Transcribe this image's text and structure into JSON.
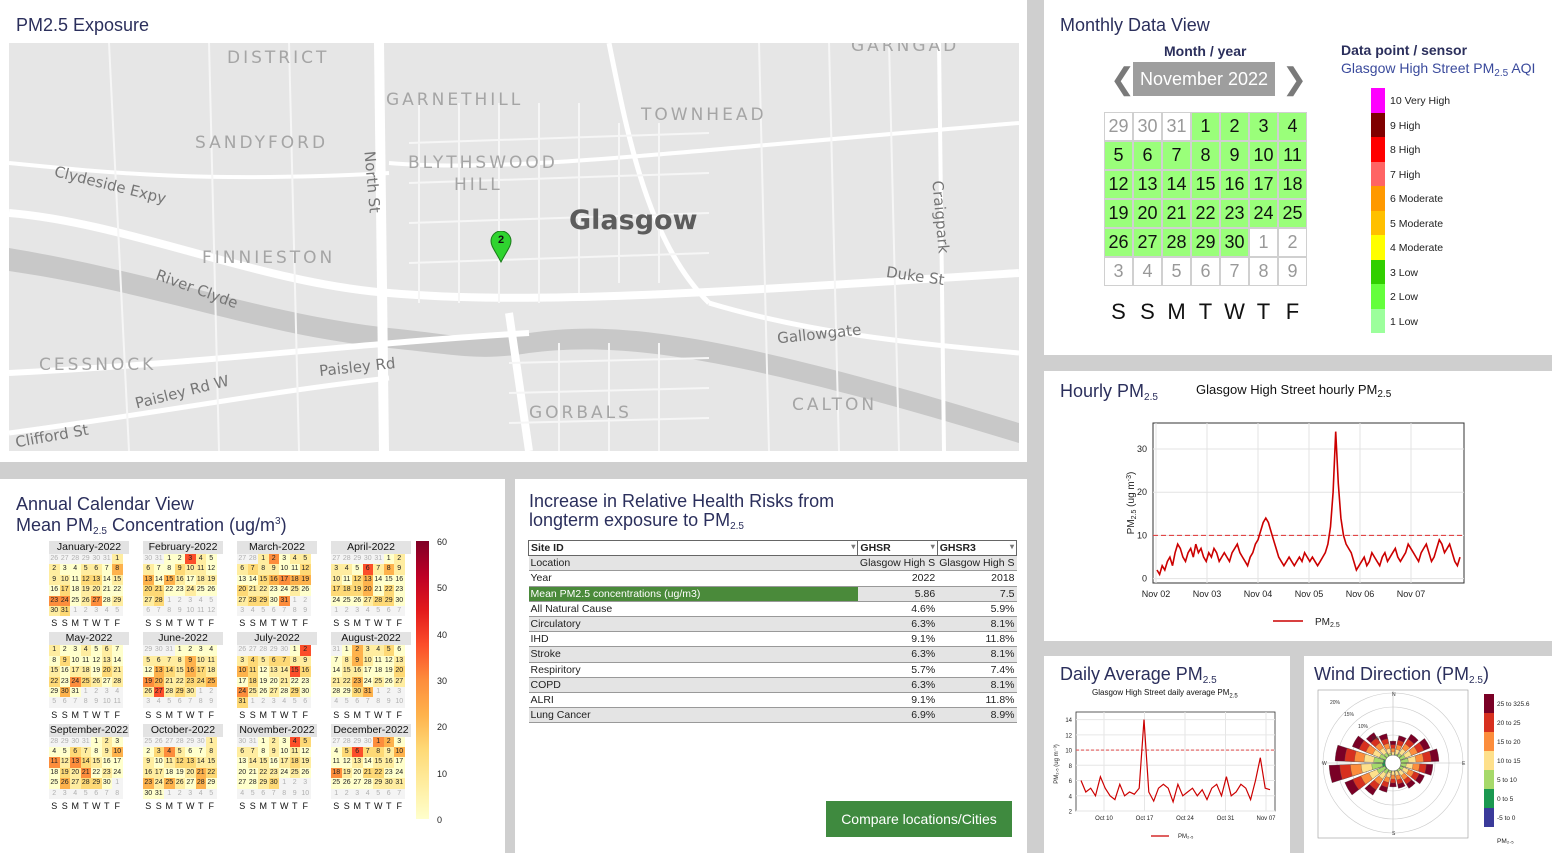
{
  "map": {
    "title": "PM2.5 Exposure",
    "labels": {
      "district": "DISTRICT",
      "garngad": "GARNGAD",
      "garnethill": "GARNETHILL",
      "townhead": "TOWNHEAD",
      "sandyford": "SANDYFORD",
      "blythswood": "BLYTHSWOOD",
      "hill": "HILL",
      "glasgow": "Glasgow",
      "finnieston": "FINNIESTON",
      "cessnock": "CESSNOCK",
      "gorbals": "GORBALS",
      "calton": "CALTON",
      "clydeside": "Clydeside Expy",
      "northst": "North St",
      "riverclyde": "River Clyde",
      "craigpark": "Craigpark",
      "dukest": "Duke St",
      "gallowgate": "Gallowgate",
      "paisleyrd": "Paisley Rd",
      "paisleyrdw": "Paisley Rd W",
      "cliffordst": "Clifford St"
    },
    "marker": "2"
  },
  "monthly": {
    "title": "Monthly Data View",
    "month_year_label": "Month / year",
    "current_month": "November 2022",
    "prev": "❮",
    "next": "❯",
    "days": [
      "29",
      "30",
      "31",
      "1",
      "2",
      "3",
      "4",
      "5",
      "6",
      "7",
      "8",
      "9",
      "10",
      "11",
      "12",
      "13",
      "14",
      "15",
      "16",
      "17",
      "18",
      "19",
      "20",
      "21",
      "22",
      "23",
      "24",
      "25",
      "26",
      "27",
      "28",
      "29",
      "30",
      "1",
      "2",
      "3",
      "4",
      "5",
      "6",
      "7",
      "8",
      "9"
    ],
    "weekdays": [
      "S",
      "S",
      "M",
      "T",
      "W",
      "T",
      "F"
    ],
    "sensor_label": "Data point / sensor",
    "sensor_name": "Glasgow High Street PM",
    "sensor_sub": "2.5",
    "sensor_suffix": " AQI",
    "aqi": [
      {
        "label": "10 Very High",
        "color": "#ff00ff"
      },
      {
        "label": "9 High",
        "color": "#800000"
      },
      {
        "label": "8 High",
        "color": "#ff0000"
      },
      {
        "label": "7 High",
        "color": "#ff6464"
      },
      {
        "label": "6 Moderate",
        "color": "#ff9900"
      },
      {
        "label": "5 Moderate",
        "color": "#ffc000"
      },
      {
        "label": "4 Moderate",
        "color": "#ffff00"
      },
      {
        "label": "3 Low",
        "color": "#31cf00"
      },
      {
        "label": "2 Low",
        "color": "#64ff3c"
      },
      {
        "label": "1 Low",
        "color": "#9cff9c"
      }
    ]
  },
  "hourly": {
    "title": "Hourly PM",
    "title_sub": "2.5",
    "chart_title": "Glasgow High Street hourly PM",
    "legend": "PM",
    "ylabel": "PM",
    "ylabel_unit": " (ug m",
    "yticks": [
      "0",
      "10",
      "20",
      "30"
    ],
    "xticks": [
      "Nov 02",
      "Nov 03",
      "Nov 04",
      "Nov 05",
      "Nov 06",
      "Nov 07"
    ]
  },
  "annual": {
    "title": "Annual Calendar View",
    "subtitle_a": "Mean PM",
    "subtitle_sub": "2.5",
    "subtitle_b": " Concentration (ug/m",
    "subtitle_sup": "3",
    "subtitle_c": ")",
    "months": [
      "January-2022",
      "February-2022",
      "March-2022",
      "April-2022",
      "May-2022",
      "June-2022",
      "July-2022",
      "August-2022",
      "September-2022",
      "October-2022",
      "November-2022",
      "December-2022"
    ],
    "weekdays": [
      "S",
      "S",
      "M",
      "T",
      "W",
      "T",
      "F"
    ],
    "scale_ticks": [
      "60",
      "50",
      "40",
      "30",
      "20",
      "10",
      "0"
    ]
  },
  "health": {
    "title_line1": "Increase in Relative Health Risks from",
    "title_line2": "longterm exposure to PM",
    "title_sub": "2.5",
    "headers": [
      "Site ID",
      "GHSR",
      "GHSR3"
    ],
    "rows": [
      [
        "Location",
        "Glasgow High S",
        "Glasgow High S"
      ],
      [
        "Year",
        "2022",
        "2018"
      ],
      [
        "Mean PM2.5 concentrations (ug/m3)",
        "5.86",
        "7.5"
      ],
      [
        "All Natural Cause",
        "4.6%",
        "5.9%"
      ],
      [
        "Circulatory",
        "6.3%",
        "8.1%"
      ],
      [
        "IHD",
        "9.1%",
        "11.8%"
      ],
      [
        "Stroke",
        "6.3%",
        "8.1%"
      ],
      [
        "Respiritory",
        "5.7%",
        "7.4%"
      ],
      [
        "COPD",
        "6.3%",
        "8.1%"
      ],
      [
        "ALRI",
        "9.1%",
        "11.8%"
      ],
      [
        "Lung Cancer",
        "6.9%",
        "8.9%"
      ]
    ],
    "button": "Compare locations/Cities"
  },
  "daily": {
    "title": "Daily Average PM",
    "title_sub": "2.5",
    "chart_title": "Glasgow High Street daily average PM",
    "yticks": [
      "2",
      "4",
      "6",
      "8",
      "10",
      "12",
      "14"
    ],
    "xticks": [
      "Oct 10",
      "Oct 17",
      "Oct 24",
      "Oct 31",
      "Nov 07"
    ],
    "legend": "PM"
  },
  "wind": {
    "title": "Wind Direction (PM",
    "title_sub": "2.5",
    "title_end": ")",
    "legend": [
      {
        "label": "25 to 325.6",
        "color": "#7a0026"
      },
      {
        "label": "20 to 25",
        "color": "#d7301f"
      },
      {
        "label": "15 to 20",
        "color": "#fc8d3c"
      },
      {
        "label": "10 to 15",
        "color": "#fee08b"
      },
      {
        "label": "5 to 10",
        "color": "#a6d96a"
      },
      {
        "label": "0 to 5",
        "color": "#1a9850"
      },
      {
        "label": "-5 to 0",
        "color": "#3a3a9a"
      }
    ],
    "legend_title": "PM",
    "pct": [
      "20%",
      "15%",
      "10%",
      "5%"
    ],
    "compass": {
      "n": "N",
      "s": "S",
      "e": "E",
      "w": "W"
    }
  },
  "chart_data": [
    {
      "type": "line",
      "title": "Glasgow High Street hourly PM2.5",
      "xlabel": "",
      "ylabel": "PM2.5 (ug m-3)",
      "ylim": [
        -1,
        36
      ],
      "x_start": "Nov 02",
      "x_end": "Nov 07",
      "threshold": 10,
      "series": [
        {
          "name": "PM2.5",
          "values": [
            2,
            1,
            3,
            2,
            4,
            5,
            3,
            6,
            8,
            7,
            5,
            4,
            6,
            7,
            5,
            8,
            6,
            7,
            5,
            4,
            6,
            5,
            7,
            6,
            4,
            5,
            6,
            5,
            4,
            6,
            7,
            8,
            6,
            5,
            4,
            3,
            5,
            6,
            8,
            9,
            11,
            13,
            14,
            13,
            11,
            9,
            7,
            5,
            4,
            3,
            4,
            5,
            4,
            3,
            4,
            5,
            4,
            6,
            5,
            4,
            5,
            4,
            3,
            4,
            5,
            6,
            8,
            12,
            20,
            34,
            22,
            14,
            10,
            8,
            7,
            6,
            4,
            2,
            3,
            4,
            5,
            3,
            4,
            6,
            5,
            4,
            3,
            5,
            6,
            4,
            5,
            6,
            7,
            5,
            4,
            5,
            6,
            8,
            7,
            6,
            5,
            4,
            6,
            7,
            8,
            6,
            4,
            5,
            7,
            9,
            8,
            6,
            7,
            8,
            6,
            4,
            3,
            5
          ]
        }
      ]
    },
    {
      "type": "line",
      "title": "Glasgow High Street daily average PM2.5",
      "ylim": [
        2,
        15
      ],
      "threshold": 10,
      "series": [
        {
          "name": "PM2.5",
          "values": [
            6,
            4.5,
            5,
            4,
            6.5,
            5,
            4,
            3.5,
            5.5,
            4,
            4.5,
            4.2,
            5,
            14,
            4.5,
            3.3,
            5,
            5.5,
            5,
            3.2,
            5.5,
            4,
            4.5,
            5,
            4,
            4.8,
            3.5,
            5,
            5.5,
            4,
            6.5,
            4,
            4.5,
            5.5,
            5,
            3.5,
            6,
            9,
            5,
            4.8
          ]
        }
      ]
    },
    {
      "type": "heatmap",
      "title": "Annual Calendar View Mean PM2.5 Concentration (ug/m3)",
      "scale": [
        0,
        60
      ]
    }
  ]
}
